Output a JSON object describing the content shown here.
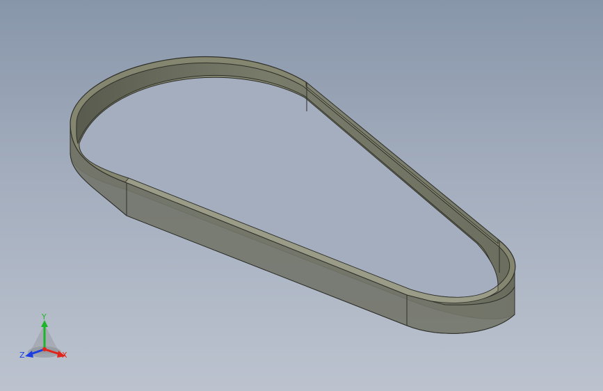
{
  "viewport": {
    "background_top": "#8896aa",
    "background_bottom": "#bcc3cf"
  },
  "model": {
    "shape": "belt-loop",
    "surface_color": "#7b7d6c",
    "inner_wall_color": "#6d6f5f",
    "edge_color": "#2e2f29"
  },
  "triad": {
    "x_label": "X",
    "y_label": "Y",
    "z_label": "Z",
    "x_color": "#e0241a",
    "y_color": "#1fb52a",
    "z_color": "#1d3fe0"
  }
}
